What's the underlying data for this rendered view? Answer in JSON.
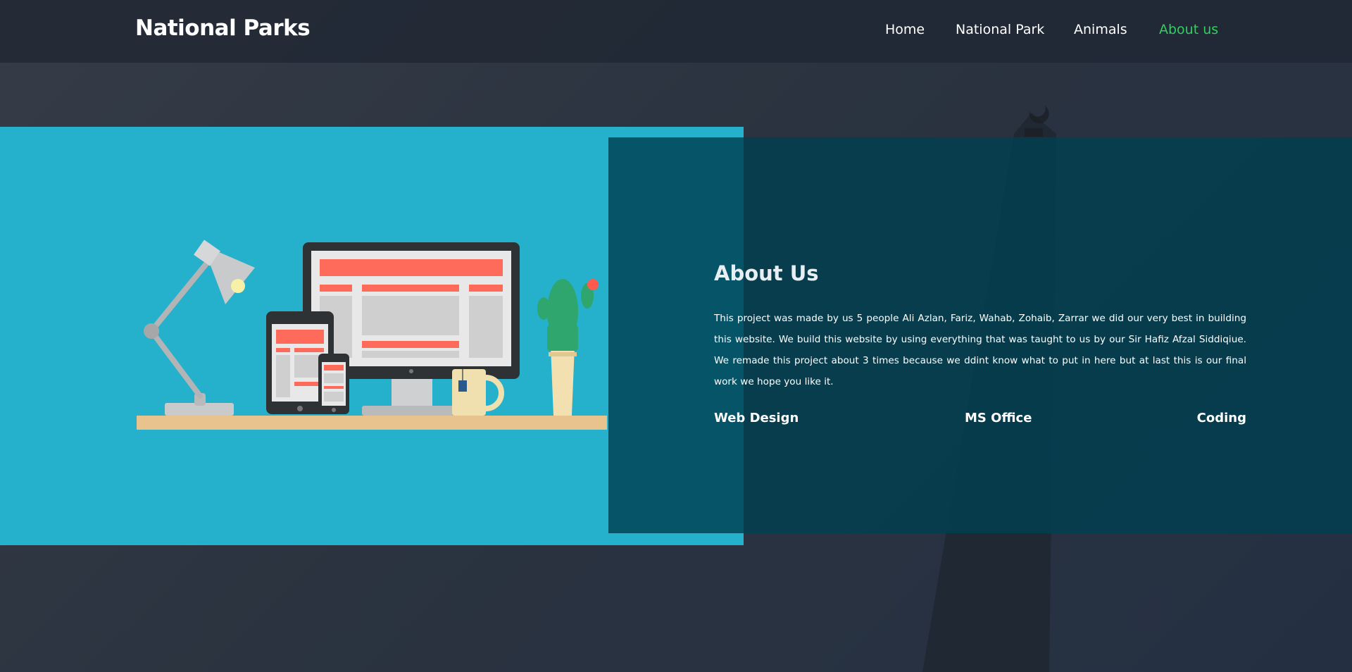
{
  "header": {
    "brand": "National Parks",
    "nav": [
      {
        "label": "Home",
        "active": false
      },
      {
        "label": "National Park",
        "active": false
      },
      {
        "label": "Animals",
        "active": false
      },
      {
        "label": "About us",
        "active": true
      }
    ],
    "active_color": "#2fd15e"
  },
  "about": {
    "title": "About Us",
    "text": "This project was made by us 5 people Ali Azlan, Fariz, Wahab, Zohaib, Zarrar we did our very best in building this website. We build this website by using everything that was taught to us by our Sir Hafiz Afzal Siddiqiue. We remade this project about 3 times because we ddint know what to put in here but at last this is our final work we hope you like it.",
    "skills": [
      "Web Design",
      "MS Office",
      "Coding"
    ]
  },
  "colors": {
    "illustration_bg": "#25b1cb",
    "info_bg": "#004050",
    "screen_accent": "#ff6b5b"
  }
}
